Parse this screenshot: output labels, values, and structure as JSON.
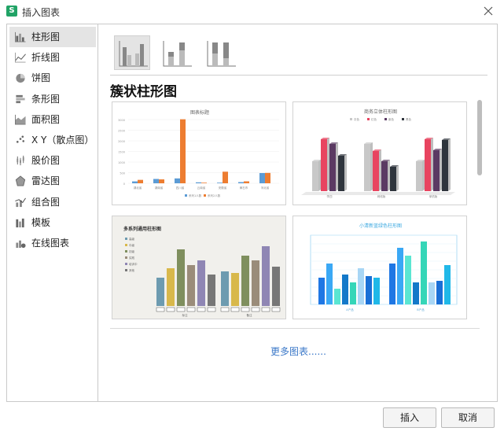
{
  "window": {
    "title": "插入图表",
    "app_icon_letter": "S"
  },
  "sidebar": {
    "items": [
      {
        "label": "柱形图",
        "icon": "column-chart-icon",
        "active": true
      },
      {
        "label": "折线图",
        "icon": "line-chart-icon"
      },
      {
        "label": "饼图",
        "icon": "pie-chart-icon"
      },
      {
        "label": "条形图",
        "icon": "bar-chart-icon"
      },
      {
        "label": "面积图",
        "icon": "area-chart-icon"
      },
      {
        "label": "X Y（散点图）",
        "icon": "scatter-chart-icon"
      },
      {
        "label": "股价图",
        "icon": "stock-chart-icon"
      },
      {
        "label": "雷达图",
        "icon": "radar-chart-icon"
      },
      {
        "label": "组合图",
        "icon": "combo-chart-icon"
      },
      {
        "label": "模板",
        "icon": "template-icon"
      },
      {
        "label": "在线图表",
        "icon": "online-chart-icon"
      }
    ]
  },
  "main": {
    "section_title": "簇状柱形图",
    "more_link": "更多图表......"
  },
  "previews": {
    "card1": {
      "title": "图表标题",
      "categories": [
        "湖北省",
        "湖南省",
        "四川省",
        "云南省",
        "安徽省",
        "黄石市",
        "河北省"
      ],
      "legend": [
        "系列1人数",
        "系列2人数"
      ],
      "ytick_labels": [
        "3000",
        "2500",
        "2000",
        "1500",
        "1000",
        "500",
        "0"
      ],
      "colors": [
        "#5b9bd5",
        "#ed7d31"
      ]
    },
    "card2": {
      "title": "商务立体柱形图",
      "legend": [
        "灰色",
        "红色",
        "紫色",
        "黑色"
      ],
      "categories": [
        "李四",
        "网络版",
        "单机版"
      ],
      "colors": [
        "#c8c8c8",
        "#e84460",
        "#5b3a63",
        "#2f353d"
      ]
    },
    "card3": {
      "title": "多系列通用柱形图",
      "legend": [
        "高级",
        "中级",
        "初级",
        "实践",
        "培训中",
        "其他"
      ],
      "categories": [
        "标注",
        "备注"
      ],
      "colors": [
        "#6d9bb0",
        "#d8b84b",
        "#7f8f5e",
        "#9a8c7a",
        "#8f86b4",
        "#777777"
      ]
    },
    "card4": {
      "title": "小清新蓝绿色柱形图",
      "categories": [
        "A产品",
        "B产品"
      ],
      "colors": [
        "#1f77e4",
        "#3aa8f5",
        "#5ae6d2",
        "#1479c9",
        "#35d6b8",
        "#a8d6f5",
        "#1a6fd6",
        "#20b8e8"
      ]
    }
  },
  "footer": {
    "insert_label": "插入",
    "cancel_label": "取消"
  }
}
